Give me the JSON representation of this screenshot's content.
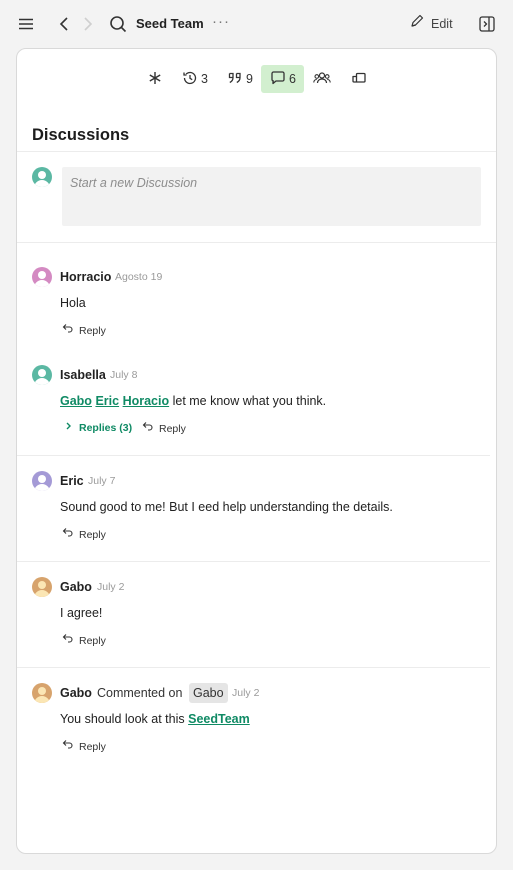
{
  "header": {
    "title": "Seed Team",
    "more_label": "···",
    "edit_label": "Edit"
  },
  "toolbar": {
    "versions_count": "3",
    "citations_count": "9",
    "discussions_count": "6"
  },
  "discussions": {
    "heading": "Discussions",
    "new_placeholder": "Start a new Discussion",
    "reply_label": "Reply",
    "comments": [
      {
        "author": "Horracio",
        "date": "Agosto 19",
        "text": "Hola"
      },
      {
        "author": "Isabella",
        "date": "July 8",
        "mentions": [
          "Gabo",
          "Eric",
          "Horacio"
        ],
        "text": "let me know what you think.",
        "replies_label": "Replies (3)"
      },
      {
        "author": "Eric",
        "date": "July 7",
        "text": "Sound good to me! But I eed help understanding the details."
      },
      {
        "author": "Gabo",
        "date": "July 2",
        "text": "I agree!"
      },
      {
        "author": "Gabo",
        "action": "Commented on",
        "target": "Gabo",
        "date": "July 2",
        "text": "You should look at this",
        "link": "SeedTeam"
      }
    ]
  },
  "colors": {
    "accent": "#0f8a64",
    "active_tab_bg": "#d2efcf",
    "avatar_teal": "#5bb8a3",
    "avatar_pink": "#d48ac2",
    "avatar_purple": "#a49ad6",
    "avatar_orange": "#d7a36c"
  }
}
